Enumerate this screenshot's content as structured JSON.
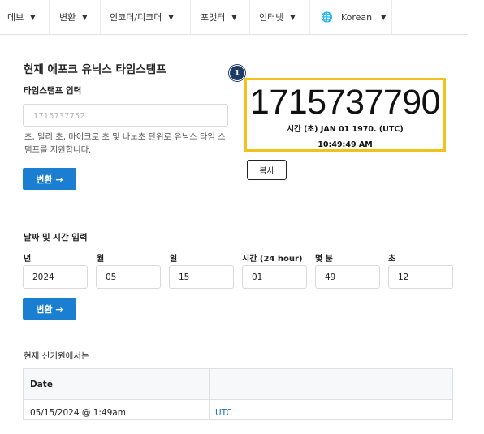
{
  "nav": {
    "items": [
      "데브",
      "변환",
      "인코더/디코더",
      "포맷터",
      "인터넷"
    ],
    "language": "Korean"
  },
  "converter": {
    "title": "현재 에포크 유닉스 타임스탬프",
    "input_label": "타임스탬프 입력",
    "input_placeholder": "1715737752",
    "help": "초, 밀리 초, 마이크로 초 및 나노초 단위로 유닉스 타임 스탬프를 지원합니다.",
    "convert_button": "변환 →"
  },
  "result": {
    "badge": "1",
    "timestamp": "1715737790",
    "line1": "시간 (초) JAN 01 1970. (UTC)",
    "line2": "10:49:49 AM",
    "copy_button": "복사"
  },
  "datetime": {
    "label": "날짜 및 시간 입력",
    "fields": [
      {
        "label": "년",
        "value": "2024"
      },
      {
        "label": "월",
        "value": "05"
      },
      {
        "label": "일",
        "value": "15"
      },
      {
        "label": "시간 (24 hour)",
        "value": "01"
      },
      {
        "label": "몇 분",
        "value": "49"
      },
      {
        "label": "초",
        "value": "12"
      }
    ],
    "convert_button": "변환 →"
  },
  "epoch": {
    "label": "현재 신기원에서는",
    "header": "Date",
    "date": "05/15/2024 @ 1:49am",
    "tz": "UTC"
  },
  "colors": {
    "accent": "#1b7fd1",
    "highlight": "#f1c21b",
    "badge": "#1e3a66"
  }
}
